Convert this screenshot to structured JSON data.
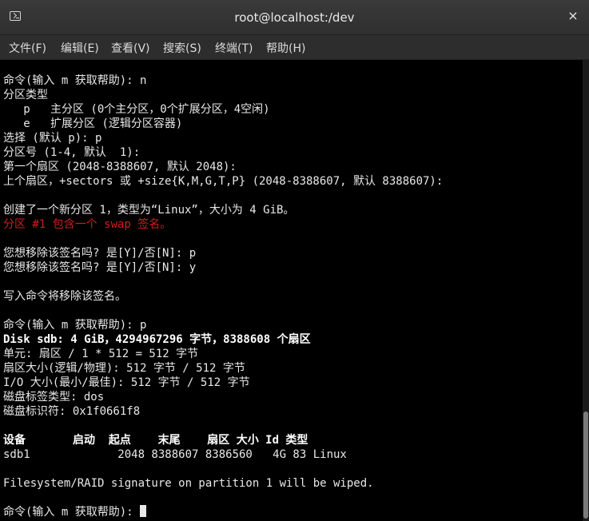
{
  "window": {
    "title": "root@localhost:/dev",
    "close_label": "×"
  },
  "menu": [
    {
      "label": "文件(F)"
    },
    {
      "label": "编辑(E)"
    },
    {
      "label": "查看(V)"
    },
    {
      "label": "搜索(S)"
    },
    {
      "label": "终端(T)"
    },
    {
      "label": "帮助(H)"
    }
  ],
  "terminal": {
    "lines": [
      "命令(输入 m 获取帮助): n",
      "分区类型",
      "   p   主分区 (0个主分区，0个扩展分区，4空闲)",
      "   e   扩展分区 (逻辑分区容器)",
      "选择 (默认 p): p",
      "分区号 (1-4, 默认  1):",
      "第一个扇区 (2048-8388607, 默认 2048):",
      "上个扇区，+sectors 或 +size{K,M,G,T,P} (2048-8388607, 默认 8388607):",
      "",
      "创建了一个新分区 1，类型为“Linux”，大小为 4 GiB。",
      "分区 #1 包含一个 swap 签名。",
      "",
      "您想移除该签名吗? 是[Y]/否[N]: p",
      "您想移除该签名吗? 是[Y]/否[N]: y",
      "",
      "写入命令将移除该签名。",
      "",
      "命令(输入 m 获取帮助): p",
      "Disk sdb: 4 GiB，4294967296 字节，8388608 个扇区",
      "单元: 扇区 / 1 * 512 = 512 字节",
      "扇区大小(逻辑/物理): 512 字节 / 512 字节",
      "I/O 大小(最小/最佳): 512 字节 / 512 字节",
      "磁盘标签类型: dos",
      "磁盘标识符: 0x1f0661f8",
      "",
      "设备       启动  起点    末尾    扇区 大小 Id 类型",
      "sdb1             2048 8388607 8386560   4G 83 Linux",
      "",
      "Filesystem/RAID signature on partition 1 will be wiped.",
      "",
      "命令(输入 m 获取帮助): "
    ]
  },
  "colors": {
    "terminal_bg": "#000000",
    "text": "#e8e8e8",
    "warning": "#cc1f1f"
  }
}
